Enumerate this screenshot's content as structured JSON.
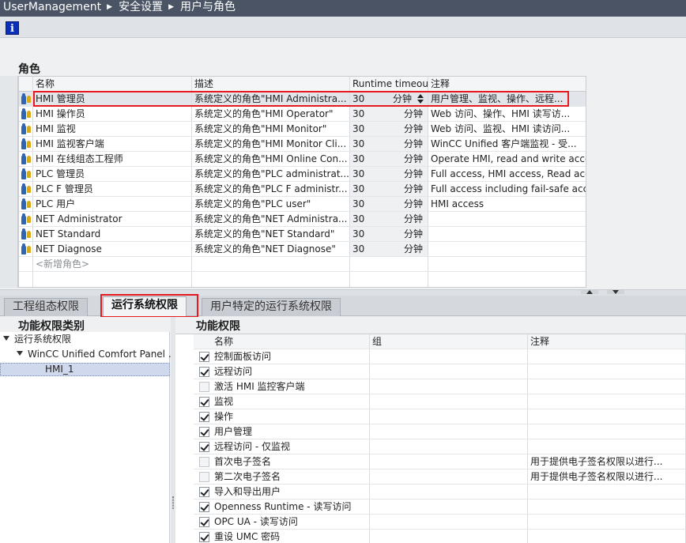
{
  "breadcrumb": [
    "UserManagement",
    "安全设置",
    "用户与角色"
  ],
  "toolbar": {
    "info_glyph": "i"
  },
  "roles_section": {
    "title": "角色",
    "columns": [
      "名称",
      "描述",
      "Runtime timeout",
      "注释"
    ],
    "rows": [
      {
        "name": "HMI 管理员",
        "desc": "系统定义的角色\"HMI Administra...",
        "timeout": "30",
        "unit": "分钟",
        "note": "用户管理、监视、操作、远程..."
      },
      {
        "name": "HMI 操作员",
        "desc": "系统定义的角色\"HMI Operator\"",
        "timeout": "30",
        "unit": "分钟",
        "note": "Web 访问、操作、HMI 读写访..."
      },
      {
        "name": "HMI 监视",
        "desc": "系统定义的角色\"HMI Monitor\"",
        "timeout": "30",
        "unit": "分钟",
        "note": "Web 访问、监视、HMI 读访问..."
      },
      {
        "name": "HMI 监视客户端",
        "desc": "系统定义的角色\"HMI Monitor Cli...",
        "timeout": "30",
        "unit": "分钟",
        "note": "WinCC Unified 客户端监视 - 受..."
      },
      {
        "name": "HMI 在线组态工程师",
        "desc": "系统定义的角色\"HMI Online Con...",
        "timeout": "30",
        "unit": "分钟",
        "note": "Operate HMI, read and write acce..."
      },
      {
        "name": "PLC 管理员",
        "desc": "系统定义的角色\"PLC administrat...",
        "timeout": "30",
        "unit": "分钟",
        "note": "Full access, HMI access, Read acc..."
      },
      {
        "name": "PLC F 管理员",
        "desc": "系统定义的角色\"PLC F administr...",
        "timeout": "30",
        "unit": "分钟",
        "note": "Full access including fail-safe acc..."
      },
      {
        "name": "PLC 用户",
        "desc": "系统定义的角色\"PLC user\"",
        "timeout": "30",
        "unit": "分钟",
        "note": "HMI access"
      },
      {
        "name": "NET Administrator",
        "desc": "系统定义的角色\"NET Administra...",
        "timeout": "30",
        "unit": "分钟",
        "note": ""
      },
      {
        "name": "NET Standard",
        "desc": "系统定义的角色\"NET Standard\"",
        "timeout": "30",
        "unit": "分钟",
        "note": ""
      },
      {
        "name": "NET Diagnose",
        "desc": "系统定义的角色\"NET Diagnose\"",
        "timeout": "30",
        "unit": "分钟",
        "note": ""
      }
    ],
    "add_new": "<新增角色>"
  },
  "tabs": [
    {
      "label": "工程组态权限",
      "active": false
    },
    {
      "label": "运行系统权限",
      "active": true
    },
    {
      "label": "用户特定的运行系统权限",
      "active": false
    }
  ],
  "categories": {
    "title": "功能权限类别",
    "tree": [
      {
        "label": "运行系统权限",
        "level": 0,
        "expanded": true
      },
      {
        "label": "WinCC Unified Comfort Panel ...",
        "level": 1,
        "expanded": true
      },
      {
        "label": "HMI_1",
        "level": 2,
        "selected": true
      }
    ]
  },
  "permissions": {
    "title": "功能权限",
    "columns": [
      "名称",
      "组",
      "注释"
    ],
    "rows": [
      {
        "name": "控制面板访问",
        "checked": true,
        "group": "",
        "note": ""
      },
      {
        "name": "远程访问",
        "checked": true,
        "group": "",
        "note": ""
      },
      {
        "name": "激活 HMI 监控客户端",
        "checked": false,
        "group": "",
        "note": ""
      },
      {
        "name": "监视",
        "checked": true,
        "group": "",
        "note": ""
      },
      {
        "name": "操作",
        "checked": true,
        "group": "",
        "note": ""
      },
      {
        "name": "用户管理",
        "checked": true,
        "group": "",
        "note": ""
      },
      {
        "name": "远程访问 - 仅监视",
        "checked": true,
        "group": "",
        "note": ""
      },
      {
        "name": "首次电子签名",
        "checked": false,
        "group": "",
        "note": "用于提供电子签名权限以进行..."
      },
      {
        "name": "第二次电子签名",
        "checked": false,
        "group": "",
        "note": "用于提供电子签名权限以进行..."
      },
      {
        "name": "导入和导出用户",
        "checked": true,
        "group": "",
        "note": ""
      },
      {
        "name": "Openness Runtime - 读写访问",
        "checked": true,
        "group": "",
        "note": ""
      },
      {
        "name": "OPC UA - 读写访问",
        "checked": true,
        "group": "",
        "note": ""
      },
      {
        "name": "重设 UMC 密码",
        "checked": true,
        "group": "",
        "note": ""
      }
    ]
  }
}
